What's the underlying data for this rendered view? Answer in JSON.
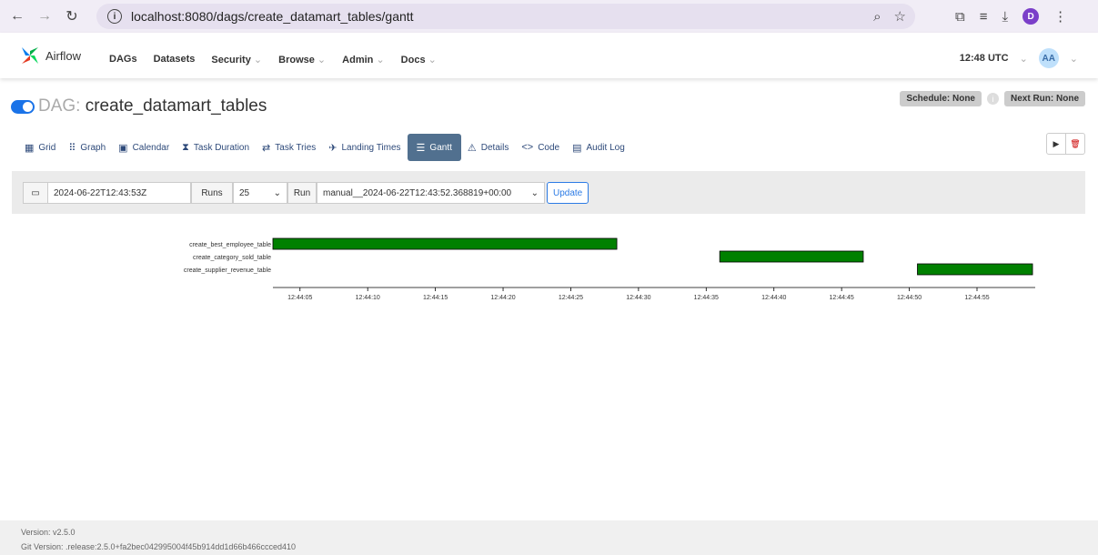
{
  "browser": {
    "url": "localhost:8080/dags/create_datamart_tables/gantt",
    "profile_initial": "D"
  },
  "nav": {
    "brand": "Airflow",
    "menu": [
      {
        "label": "DAGs",
        "dropdown": false
      },
      {
        "label": "Datasets",
        "dropdown": false
      },
      {
        "label": "Security",
        "dropdown": true
      },
      {
        "label": "Browse",
        "dropdown": true
      },
      {
        "label": "Admin",
        "dropdown": true
      },
      {
        "label": "Docs",
        "dropdown": true
      }
    ],
    "time": "12:48 UTC",
    "avatar": "AA"
  },
  "dag": {
    "label": "DAG:",
    "name": "create_datamart_tables",
    "schedule": "Schedule: None",
    "next_run": "Next Run: None"
  },
  "tabs": [
    {
      "label": "Grid",
      "icon": "grid-icon",
      "glyph": "▦"
    },
    {
      "label": "Graph",
      "icon": "graph-icon",
      "glyph": "⠿"
    },
    {
      "label": "Calendar",
      "icon": "calendar-icon",
      "glyph": "▣"
    },
    {
      "label": "Task Duration",
      "icon": "hourglass-icon",
      "glyph": "⧗"
    },
    {
      "label": "Task Tries",
      "icon": "tries-icon",
      "glyph": "⇄"
    },
    {
      "label": "Landing Times",
      "icon": "landing-icon",
      "glyph": "✈"
    },
    {
      "label": "Gantt",
      "icon": "gantt-icon",
      "glyph": "☰",
      "active": true
    },
    {
      "label": "Details",
      "icon": "warning-icon",
      "glyph": "⚠"
    },
    {
      "label": "Code",
      "icon": "code-icon",
      "glyph": "<>"
    },
    {
      "label": "Audit Log",
      "icon": "audit-icon",
      "glyph": "▤"
    }
  ],
  "filter": {
    "date": "2024-06-22T12:43:53Z",
    "runs_label": "Runs",
    "runs_value": "25",
    "run_label": "Run",
    "run_value": "manual__2024-06-22T12:43:52.368819+00:00",
    "update": "Update"
  },
  "gantt": {
    "bar_color": "#008000",
    "axis_start": "12:44:03.0",
    "axis_end": "12:44:59.3",
    "ticks": [
      "12:44:05",
      "12:44:10",
      "12:44:15",
      "12:44:20",
      "12:44:25",
      "12:44:30",
      "12:44:35",
      "12:44:40",
      "12:44:45",
      "12:44:50",
      "12:44:55"
    ],
    "tasks": [
      {
        "name": "create_best_employee_table",
        "start": "12:44:03.0",
        "end": "12:44:28.4"
      },
      {
        "name": "create_category_sold_table",
        "start": "12:44:36.0",
        "end": "12:44:46.6"
      },
      {
        "name": "create_supplier_revenue_table",
        "start": "12:44:50.6",
        "end": "12:44:59.1"
      }
    ]
  },
  "footer": {
    "version": "Version: v2.5.0",
    "git": "Git Version: .release:2.5.0+fa2bec042995004f45b914dd1d66b466ccced410"
  }
}
